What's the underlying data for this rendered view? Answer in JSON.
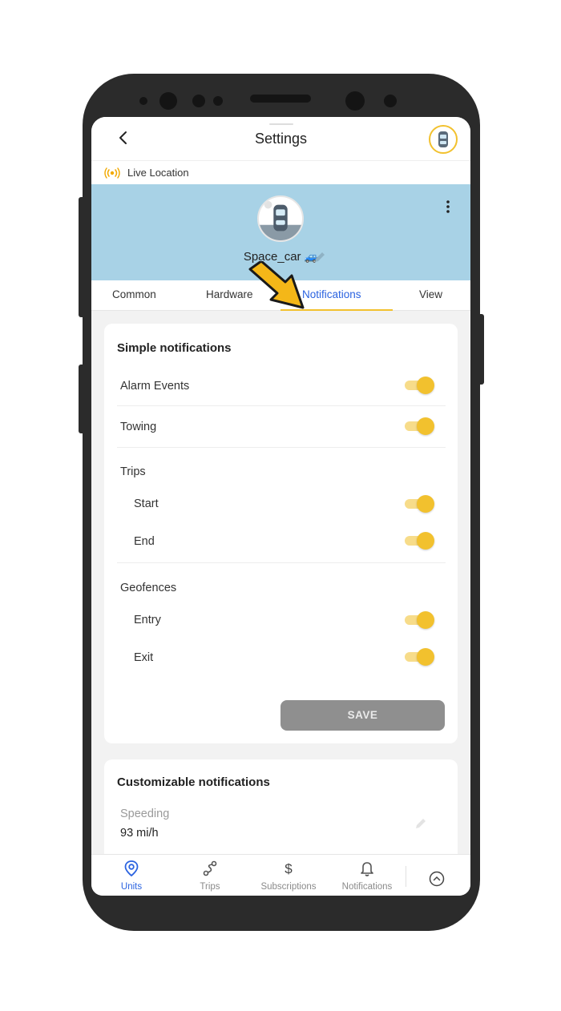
{
  "header": {
    "title": "Settings"
  },
  "live_location": {
    "label": "Live Location"
  },
  "unit": {
    "name": "Space_car",
    "emoji": "🚙"
  },
  "tabs": [
    {
      "label": "Common"
    },
    {
      "label": "Hardware"
    },
    {
      "label": "Notifications",
      "active": true
    },
    {
      "label": "View"
    }
  ],
  "simple_notifications": {
    "title": "Simple notifications",
    "alarm_events": {
      "label": "Alarm Events",
      "on": true
    },
    "towing": {
      "label": "Towing",
      "on": true
    },
    "trips": {
      "label": "Trips",
      "start": {
        "label": "Start",
        "on": true
      },
      "end": {
        "label": "End",
        "on": true
      }
    },
    "geofences": {
      "label": "Geofences",
      "entry": {
        "label": "Entry",
        "on": true
      },
      "exit": {
        "label": "Exit",
        "on": true
      }
    },
    "save_label": "SAVE"
  },
  "customizable_notifications": {
    "title": "Customizable notifications",
    "speeding": {
      "label": "Speeding",
      "value": "93 mi/h"
    }
  },
  "bottom_nav": [
    {
      "label": "Units",
      "icon": "location-pin-icon",
      "active": true
    },
    {
      "label": "Trips",
      "icon": "route-icon"
    },
    {
      "label": "Subscriptions",
      "icon": "dollar-icon"
    },
    {
      "label": "Notifications",
      "icon": "bell-icon"
    }
  ],
  "colors": {
    "accent_yellow": "#f2c12e",
    "active_blue": "#2b63e0",
    "banner_blue": "#a8d2e6",
    "save_gray": "#8f8f8f"
  }
}
